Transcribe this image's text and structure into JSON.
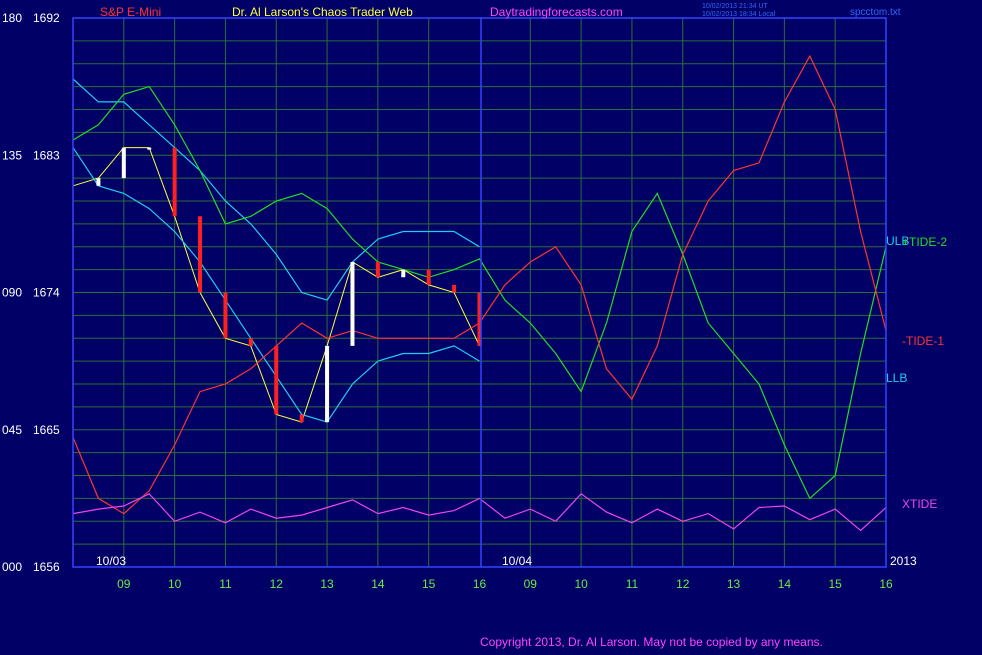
{
  "header": {
    "symbol": "S&P E-Mini",
    "title": "Dr. Al Larson's Chaos Trader Web",
    "site": "Daytradingforecasts.com",
    "stamp_line1": "10/02/2013 21:34 UT",
    "stamp_line2": "10/02/2013 18:34 Local",
    "file": "spcctom.txt"
  },
  "footer": {
    "copyright": "Copyright 2013, Dr. Al Larson. May not be copied by any means."
  },
  "colors": {
    "background": "#000066",
    "grid": "#2a6e3a",
    "frame": "#3344ff",
    "price_up": "#ffffff",
    "price_down": "#ff2020",
    "band": "#22ccee",
    "avg_yellow": "#ffff44",
    "red_line": "#ff3030",
    "tide_green": "#22dd22",
    "tide_red": "#ff3333",
    "xtide": "#ee44ee",
    "left_labels": "#ffffff",
    "time_labels": "#66ee44",
    "symbol_text": "#ff3333",
    "title_text": "#ffff44",
    "site_text": "#ff44ff"
  },
  "chart_data": {
    "type": "line",
    "title": "S&P E-Mini",
    "y_left_cycle": [
      "180",
      "135",
      "090",
      "045",
      "000"
    ],
    "y_price": [
      "1692",
      "1683",
      "1674",
      "1665",
      "1656"
    ],
    "ylim": [
      1656,
      1692
    ],
    "x_tick_labels": [
      "09",
      "10",
      "11",
      "12",
      "13",
      "14",
      "15",
      "16",
      "09",
      "10",
      "11",
      "12",
      "13",
      "14",
      "15",
      "16"
    ],
    "date_labels": [
      "10/03",
      "10/04",
      "2013"
    ],
    "series_labels": [
      "ULB",
      "+TIDE-2",
      "-TIDE-1",
      "LLB",
      "XTIDE"
    ],
    "x": [
      8.0,
      8.5,
      9.0,
      9.5,
      10.0,
      10.5,
      11.0,
      11.5,
      12.0,
      12.5,
      13.0,
      13.5,
      14.0,
      14.5,
      15.0,
      15.5,
      16.0,
      16.5,
      17.0,
      17.5,
      18.0,
      18.5,
      19.0,
      19.5,
      20.0,
      20.5,
      21.0,
      21.5,
      22.0,
      22.5,
      23.0,
      23.5,
      24.0
    ],
    "series": [
      {
        "name": "price",
        "values": [
          1681.0,
          1681.5,
          1683.5,
          1683.5,
          1679.0,
          1674.0,
          1671.0,
          1670.5,
          1666.0,
          1665.5,
          1670.5,
          1676.0,
          1675.0,
          1675.5,
          1674.5,
          1674.0,
          1670.5,
          null,
          null,
          null,
          null,
          null,
          null,
          null,
          null,
          null,
          null,
          null,
          null,
          null,
          null,
          null,
          null
        ]
      },
      {
        "name": "ULB",
        "values": [
          1688.0,
          1686.5,
          1686.5,
          1685.0,
          1683.5,
          1682.0,
          1680.0,
          1678.5,
          1676.5,
          1674.0,
          1673.5,
          1676.0,
          1677.5,
          1678.0,
          1678.0,
          1678.0,
          1677.0,
          null,
          null,
          null,
          null,
          null,
          null,
          null,
          null,
          null,
          null,
          null,
          null,
          null,
          null,
          null,
          1677.2
        ]
      },
      {
        "name": "LLB",
        "values": [
          1683.5,
          1681.0,
          1680.5,
          1679.5,
          1678.0,
          1676.0,
          1673.5,
          1671.0,
          1668.5,
          1666.0,
          1665.5,
          1668.0,
          1669.5,
          1670.0,
          1670.0,
          1670.5,
          1669.5,
          null,
          null,
          null,
          null,
          null,
          null,
          null,
          null,
          null,
          null,
          null,
          null,
          null,
          null,
          null,
          1668.7
        ]
      },
      {
        "name": "+TIDE-2",
        "values": [
          1684.0,
          1685.0,
          1687.0,
          1687.5,
          1685.0,
          1682.0,
          1678.5,
          1679.0,
          1680.0,
          1680.5,
          1679.5,
          1677.5,
          1676.0,
          1675.5,
          1675.0,
          1675.5,
          1676.2,
          1673.5,
          1672.0,
          1670.0,
          1667.5,
          1672.0,
          1678.0,
          1680.5,
          1676.5,
          1672.0,
          1670.0,
          1668.0,
          1664.0,
          1660.5,
          1662.0,
          1670.0,
          1677.0
        ]
      },
      {
        "name": "-TIDE-1",
        "values": [
          1664.5,
          1660.5,
          1659.5,
          1661.0,
          1664.0,
          1667.5,
          1668.0,
          1669.0,
          1670.5,
          1672.0,
          1671.0,
          1671.5,
          1671.0,
          1671.0,
          1671.0,
          1671.0,
          1672.0,
          1674.5,
          1676.0,
          1677.0,
          1674.5,
          1669.0,
          1667.0,
          1670.5,
          1676.5,
          1680.0,
          1682.0,
          1682.5,
          1686.5,
          1689.5,
          1686.0,
          1678.0,
          1671.5
        ]
      },
      {
        "name": "XTIDE",
        "values": [
          1659.5,
          1659.8,
          1660.0,
          1660.8,
          1659.0,
          1659.6,
          1658.9,
          1659.8,
          1659.2,
          1659.4,
          1659.9,
          1660.4,
          1659.5,
          1659.9,
          1659.4,
          1659.7,
          1660.5,
          1659.2,
          1659.8,
          1659.0,
          1660.8,
          1659.6,
          1658.9,
          1659.8,
          1659.0,
          1659.5,
          1658.5,
          1659.9,
          1660.0,
          1659.1,
          1659.8,
          1658.4,
          1659.9
        ]
      }
    ]
  }
}
